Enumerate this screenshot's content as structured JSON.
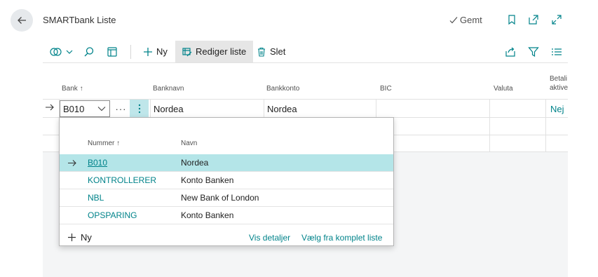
{
  "header": {
    "title": "SMARTbank Liste",
    "saved_label": "Gemt"
  },
  "toolbar": {
    "new_label": "Ny",
    "edit_list_label": "Rediger liste",
    "delete_label": "Slet"
  },
  "grid": {
    "columns": {
      "bank": "Bank",
      "banknavn": "Banknavn",
      "bankkonto": "Bankkonto",
      "bic": "BIC",
      "valuta": "Valuta",
      "betaling_1": "Betali",
      "betaling_2": "aktive"
    },
    "row": {
      "bank": "B010",
      "banknavn": "Nordea",
      "bankkonto": "Nordea",
      "betaling": "Nej"
    }
  },
  "lookup": {
    "columns": {
      "nummer": "Nummer",
      "navn": "Navn"
    },
    "rows": [
      {
        "nummer": "B010",
        "navn": "Nordea"
      },
      {
        "nummer": "KONTROLLERER",
        "navn": "Konto Banken"
      },
      {
        "nummer": "NBL",
        "navn": "New Bank of London"
      },
      {
        "nummer": "OPSPARING",
        "navn": "Konto Banken"
      }
    ],
    "new_label": "Ny",
    "details_label": "Vis detaljer",
    "full_list_label": "Vælg fra komplet liste"
  },
  "colors": {
    "accent": "#00838a",
    "selected_row": "#b4e5e8"
  }
}
